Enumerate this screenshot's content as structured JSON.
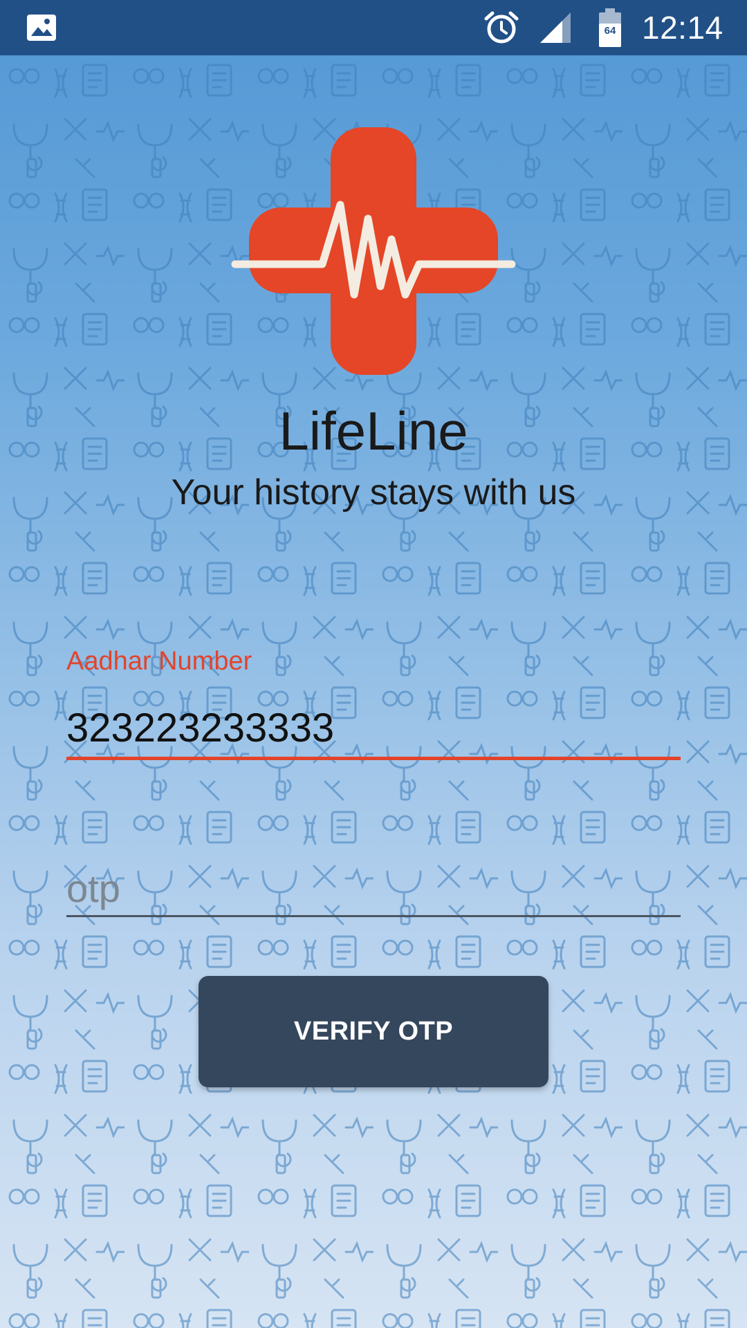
{
  "status_bar": {
    "notification_icon": "gallery-icon",
    "alarm_icon": "alarm-clock-icon",
    "signal_icon": "cellular-signal-icon",
    "battery_icon": "battery-icon",
    "battery_level": "64",
    "time": "12:14"
  },
  "app": {
    "logo_icon": "medical-cross-heartbeat-icon",
    "title": "LifeLine",
    "tagline": "Your history stays with us",
    "accent_color": "#e2442b",
    "button_color": "#34475c"
  },
  "form": {
    "aadhar": {
      "label": "Aadhar Number",
      "value": "323223233333"
    },
    "otp": {
      "placeholder": "otp",
      "value": ""
    },
    "verify_label": "VERIFY OTP"
  }
}
